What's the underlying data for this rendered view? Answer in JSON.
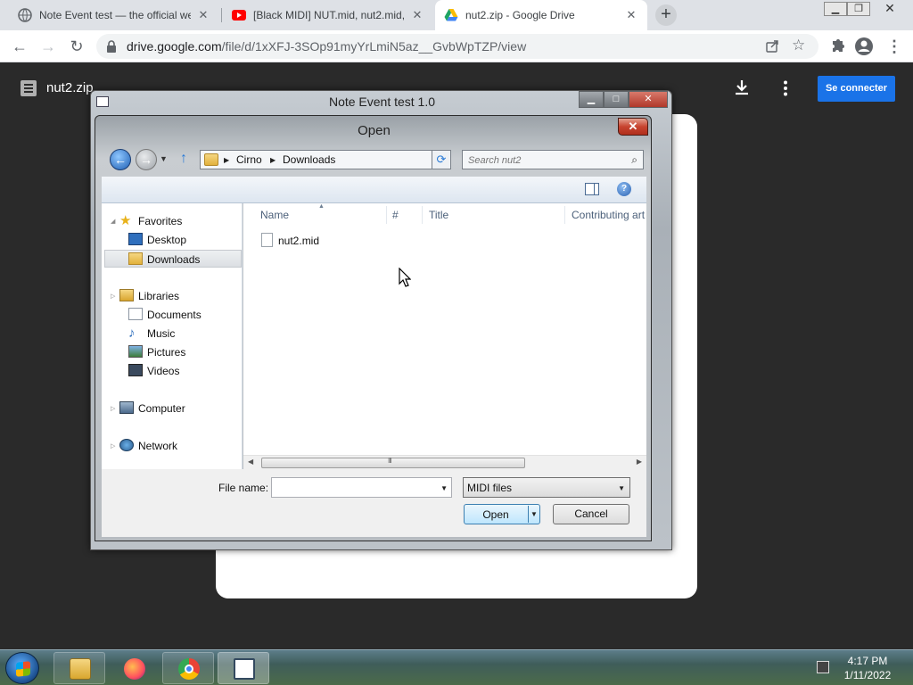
{
  "browser": {
    "tabs": [
      {
        "title": "Note Event test — the official we",
        "favicon": "firefox-like-icon"
      },
      {
        "title": "[Black MIDI] NUT.mid, nut2.mid, (",
        "favicon": "youtube-icon"
      },
      {
        "title": "nut2.zip - Google Drive",
        "favicon": "google-drive-icon",
        "active": true
      }
    ],
    "url_main": "drive.google.com",
    "url_rest": "/file/d/1xXFJ-3SOp91myYrLmiN5az__GvbWpTZP/view"
  },
  "drive": {
    "file_name": "nut2.zip",
    "signin_label": "Se connecter"
  },
  "app_window": {
    "title": "Note Event test 1.0"
  },
  "dialog": {
    "title": "Open",
    "breadcrumb": [
      "Cirno",
      "Downloads"
    ],
    "search_placeholder": "Search nut2",
    "nav": {
      "favorites_label": "Favorites",
      "favorites": [
        "Desktop",
        "Downloads"
      ],
      "selected": "Downloads",
      "libraries_label": "Libraries",
      "libraries": [
        "Documents",
        "Music",
        "Pictures",
        "Videos"
      ],
      "computer": "Computer",
      "network": "Network"
    },
    "columns": [
      "Name",
      "#",
      "Title",
      "Contributing art"
    ],
    "files": [
      {
        "name": "nut2.mid"
      }
    ],
    "file_name_label": "File name:",
    "file_name_value": "",
    "filter": "MIDI files",
    "open_label": "Open",
    "cancel_label": "Cancel"
  },
  "taskbar": {
    "time": "4:17 PM",
    "date": "1/11/2022"
  }
}
